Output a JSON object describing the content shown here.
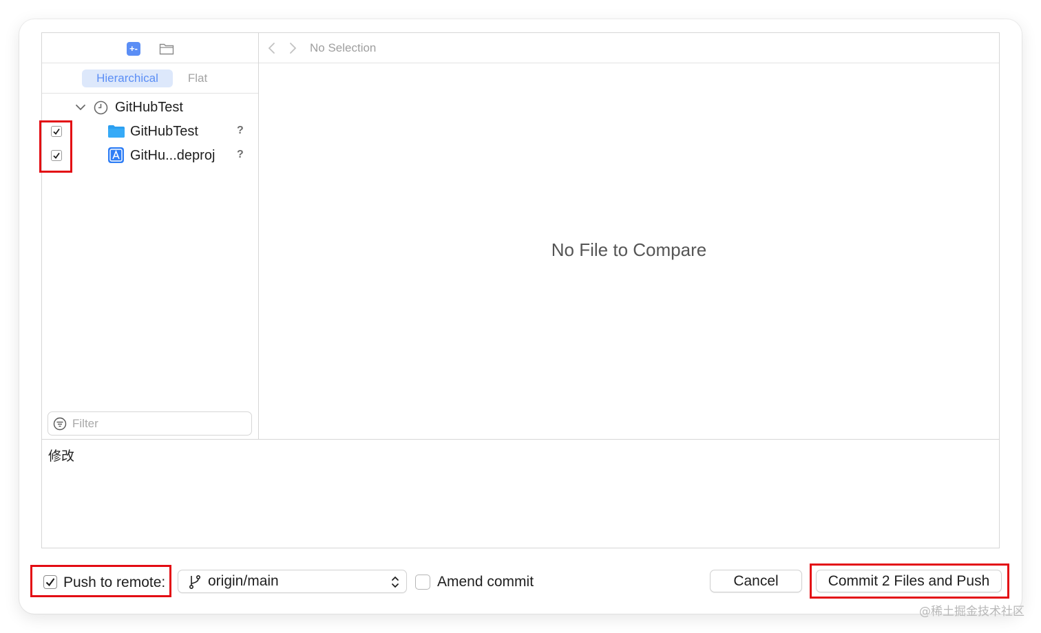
{
  "sidebar": {
    "segments": {
      "hierarchical": "Hierarchical",
      "flat": "Flat"
    },
    "tree": {
      "root": {
        "label": "GitHubTest",
        "icon": "clock-icon"
      },
      "items": [
        {
          "label": "GitHubTest",
          "icon": "folder-icon",
          "checked": true,
          "status": "?"
        },
        {
          "label": "GitHu...deproj",
          "icon": "xcode-project-icon",
          "checked": true,
          "status": "?"
        }
      ]
    },
    "filter_placeholder": "Filter"
  },
  "compare": {
    "breadcrumb": "No Selection",
    "empty_message": "No File to Compare"
  },
  "commit_message": "修改",
  "footer": {
    "push_label": "Push to remote:",
    "push_checked": true,
    "branch": "origin/main",
    "amend_label": "Amend commit",
    "amend_checked": false,
    "cancel_label": "Cancel",
    "commit_label": "Commit 2 Files and Push"
  },
  "watermark": "@稀土掘金技术社区",
  "colors": {
    "accent": "#5b8ef5",
    "highlight": "#e30b13",
    "border": "#d6d6d6"
  }
}
